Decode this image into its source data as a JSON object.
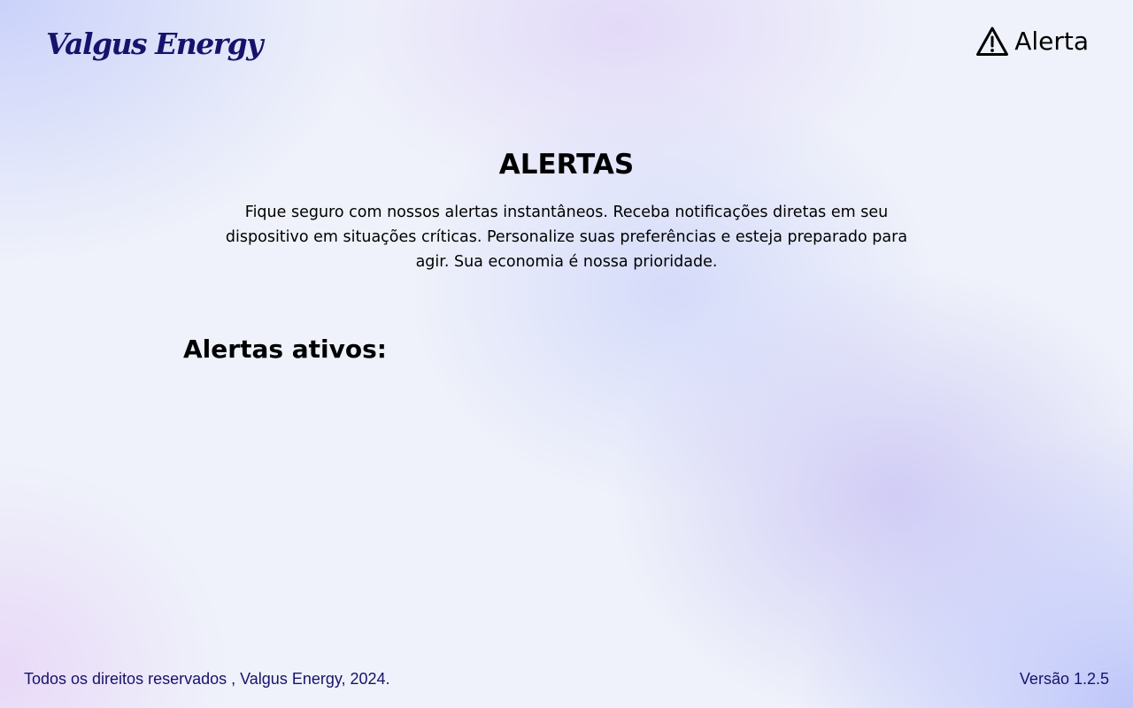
{
  "header": {
    "logo_text": "Valgus Energy",
    "alert_link": {
      "icon": "warning-triangle-icon",
      "label": "Alerta"
    }
  },
  "main": {
    "title": "ALERTAS",
    "description": "Fique seguro com nossos alertas instantâneos. Receba notificações diretas em seu dispositivo em situações críticas. Personalize suas preferências e esteja preparado para agir. Sua economia é nossa prioridade.",
    "active_alerts_heading": "Alertas ativos:",
    "active_alerts": []
  },
  "footer": {
    "copyright": "Todos os direitos reservados , Valgus Energy, 2024.",
    "version": "Versão 1.2.5"
  },
  "colors": {
    "brand": "#17126b",
    "text": "#000000",
    "background": "#eff2fa"
  }
}
